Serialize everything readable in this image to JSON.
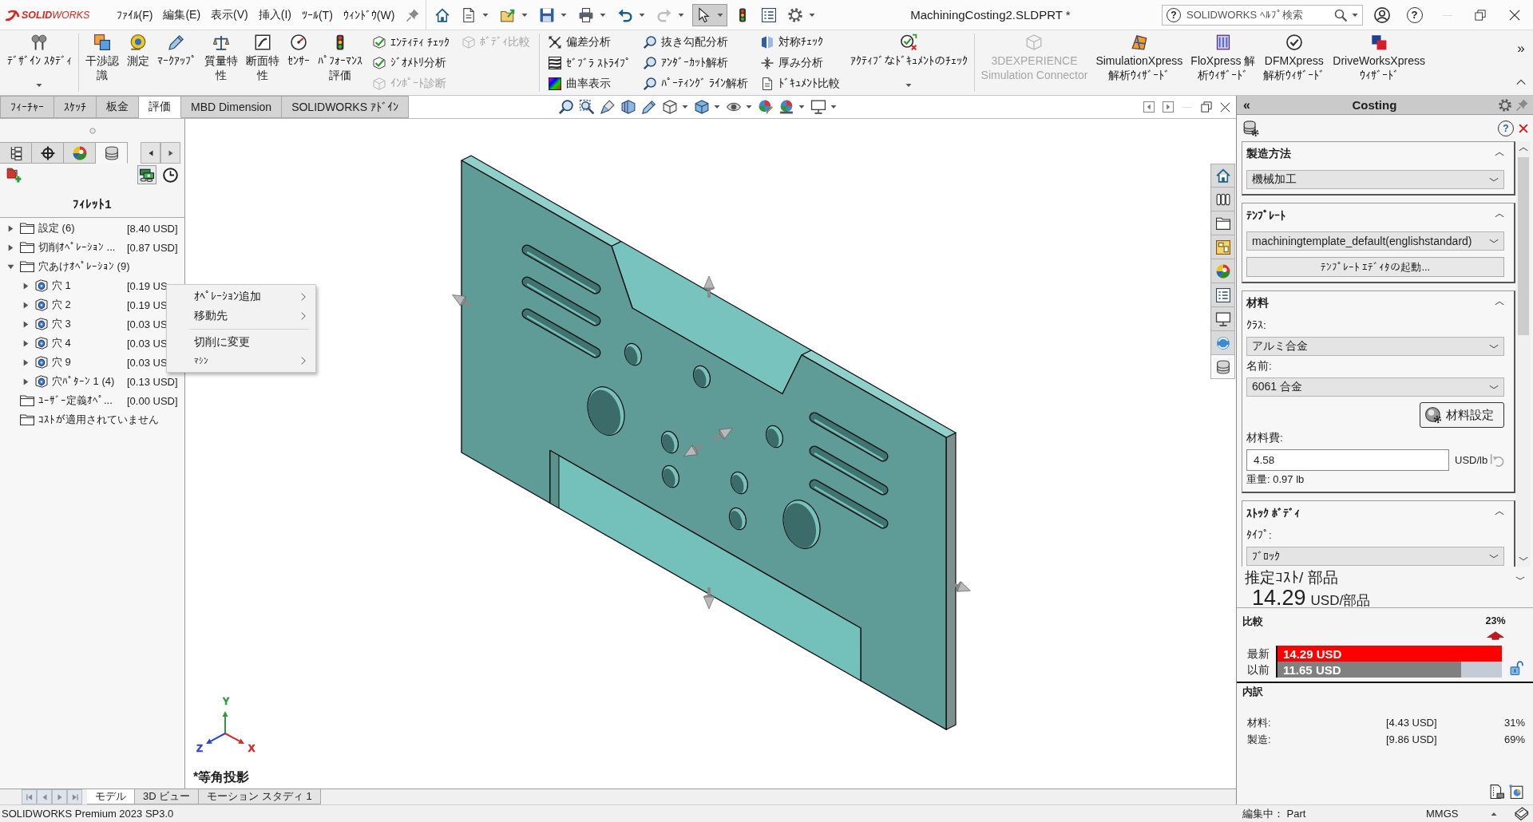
{
  "title_bar": {
    "logo": "**SOLID**WORKS",
    "menus": [
      "ﾌｧｲﾙ(F)",
      "編集(E)",
      "表示(V)",
      "挿入(I)",
      "ﾂｰﾙ(T)",
      "ｳｨﾝﾄﾞｳ(W)"
    ],
    "document_title": "MachiningCosting2.SLDPRT *",
    "search": {
      "help": "?",
      "placeholder": "SOLIDWORKS ﾍﾙﾌﾟ検索"
    },
    "help": "?"
  },
  "quick_access": [
    {
      "kind": "home",
      "dropdown": false,
      "selected": false,
      "disabled": false
    },
    {
      "kind": "new",
      "dropdown": true,
      "selected": false,
      "disabled": false
    },
    {
      "kind": "open",
      "dropdown": true,
      "selected": false,
      "disabled": false
    },
    {
      "kind": "save",
      "dropdown": true,
      "selected": false,
      "disabled": false
    },
    {
      "kind": "print",
      "dropdown": true,
      "selected": false,
      "disabled": false
    },
    {
      "kind": "undo",
      "dropdown": true,
      "selected": false,
      "disabled": false
    },
    {
      "kind": "redo",
      "dropdown": true,
      "selected": false,
      "disabled": true
    },
    {
      "kind": "select",
      "dropdown": true,
      "selected": true,
      "disabled": false
    },
    {
      "kind": "rebuild",
      "dropdown": false,
      "selected": false,
      "disabled": false
    },
    {
      "kind": "file_properties",
      "dropdown": false,
      "selected": false,
      "disabled": false
    },
    {
      "kind": "options",
      "dropdown": true,
      "selected": false,
      "disabled": false
    }
  ],
  "ribbon": [
    {
      "kind": "large",
      "lines": [
        "ﾃﾞｻﾞｲﾝ ｽﾀﾃﾞｨ"
      ],
      "dropdown": true,
      "disabled": false
    },
    {
      "kind": "separator"
    },
    {
      "kind": "large",
      "lines": [
        "干渉認",
        "識"
      ],
      "dropdown": false,
      "disabled": false
    },
    {
      "kind": "large",
      "lines": [
        "測定"
      ],
      "dropdown": false,
      "disabled": false
    },
    {
      "kind": "large",
      "lines": [
        "ﾏｰｸｱｯﾌﾟ"
      ],
      "dropdown": false,
      "disabled": false
    },
    {
      "kind": "large",
      "lines": [
        "質量特",
        "性"
      ],
      "dropdown": false,
      "disabled": false
    },
    {
      "kind": "large",
      "lines": [
        "断面特",
        "性"
      ],
      "dropdown": false,
      "disabled": false
    },
    {
      "kind": "large",
      "lines": [
        "ｾﾝｻｰ"
      ],
      "dropdown": false,
      "disabled": false
    },
    {
      "kind": "large",
      "lines": [
        "ﾊﾟﾌｫｰﾏﾝｽ",
        "評価"
      ],
      "dropdown": false,
      "disabled": false
    },
    {
      "kind": "stack",
      "items": [
        {
          "label": "ｴﾝﾃｨﾃｨ ﾁｪｯｸ",
          "disabled": false
        },
        {
          "label": "ｼﾞｵﾒﾄﾘ分析",
          "disabled": false
        },
        {
          "label": "ｲﾝﾎﾟｰﾄ診断",
          "disabled": true
        }
      ]
    },
    {
      "kind": "stack",
      "items": [
        {
          "label": "ﾎﾞﾃﾞｨ比較",
          "disabled": true
        }
      ]
    },
    {
      "kind": "separator"
    },
    {
      "kind": "stack",
      "items": [
        {
          "label": "偏差分析",
          "disabled": false
        },
        {
          "label": "ｾﾞﾌﾞﾗ ｽﾄﾗｲﾌﾟ",
          "disabled": false
        },
        {
          "label": "曲率表示",
          "disabled": false
        }
      ]
    },
    {
      "kind": "stack",
      "items": [
        {
          "label": "抜き勾配分析",
          "disabled": false
        },
        {
          "label": "ｱﾝﾀﾞｰｶｯﾄ解析",
          "disabled": false
        },
        {
          "label": "ﾊﾟｰﾃｨﾝｸﾞ ﾗｲﾝ解析",
          "disabled": false
        }
      ]
    },
    {
      "kind": "stack",
      "items": [
        {
          "label": "対称ﾁｪｯｸ",
          "disabled": false
        },
        {
          "label": "厚み分析",
          "disabled": false
        },
        {
          "label": "ﾄﾞｷｭﾒﾝﾄ比較",
          "disabled": false
        }
      ]
    },
    {
      "kind": "large",
      "lines": [
        "ｱｸﾃｨﾌﾞなﾄﾞｷｭﾒﾝﾄのﾁｪｯｸ"
      ],
      "dropdown": true,
      "disabled": false
    },
    {
      "kind": "separator"
    },
    {
      "kind": "large",
      "lines": [
        "3DEXPERIENCE",
        "Simulation Connector"
      ],
      "dropdown": false,
      "disabled": true
    },
    {
      "kind": "large",
      "lines": [
        "SimulationXpress",
        "解析ｳｨｻﾞｰﾄﾞ"
      ],
      "dropdown": false,
      "disabled": false
    },
    {
      "kind": "large",
      "lines": [
        "FloXpress 解",
        "析ｳｨｻﾞｰﾄﾞ"
      ],
      "dropdown": false,
      "disabled": false
    },
    {
      "kind": "large",
      "lines": [
        "DFMXpress",
        "解析ｳｨｻﾞｰﾄﾞ"
      ],
      "dropdown": false,
      "disabled": false
    },
    {
      "kind": "large",
      "lines": [
        "DriveWorksXpress",
        "ｳｨｻﾞｰﾄﾞ"
      ],
      "dropdown": false,
      "disabled": false
    }
  ],
  "ribbon_more": "»",
  "command_tabs": [
    {
      "label": "ﾌｨｰﾁｬｰ",
      "selected": false
    },
    {
      "label": "ｽｹｯﾁ",
      "selected": false
    },
    {
      "label": "板金",
      "selected": false
    },
    {
      "label": "評価",
      "selected": true
    },
    {
      "label": "MBD Dimension",
      "selected": false
    },
    {
      "label": "SOLIDWORKS ｱﾄﾞｲﾝ",
      "selected": false
    }
  ],
  "manager_tabs": [
    {
      "kind": "feature_tree",
      "selected": false
    },
    {
      "kind": "property",
      "selected": false
    },
    {
      "kind": "display",
      "selected": false
    },
    {
      "kind": "costing",
      "selected": true
    }
  ],
  "cost_tree": {
    "title": "ﾌｨﾚｯﾄ1",
    "items": [
      {
        "kind": "folder",
        "label": "設定 (6)",
        "cost": "[8.40 USD]",
        "expanded": false
      },
      {
        "kind": "folder",
        "label": "切削ｵﾍﾟﾚｰｼｮﾝ ...",
        "cost": "[0.87 USD]",
        "expanded": false
      },
      {
        "kind": "folder",
        "label": "穴あけｵﾍﾟﾚｰｼｮﾝ (9)",
        "expanded": true,
        "children": [
          {
            "kind": "hole",
            "label": "穴 1",
            "cost": "[0.19 US",
            "expanded": false
          },
          {
            "kind": "hole",
            "label": "穴 2",
            "cost": "[0.19 US",
            "expanded": false
          },
          {
            "kind": "hole",
            "label": "穴 3",
            "cost": "[0.03 US",
            "expanded": false
          },
          {
            "kind": "hole",
            "label": "穴 4",
            "cost": "[0.03 US",
            "expanded": false
          },
          {
            "kind": "hole",
            "label": "穴 9",
            "cost": "[0.03 US",
            "expanded": false
          },
          {
            "kind": "hole",
            "label": "穴ﾊﾟﾀｰﾝ 1 (4)",
            "cost": "[0.13 USD]",
            "expanded": false
          }
        ]
      },
      {
        "kind": "folder",
        "label": "ﾕｰｻﾞｰ定義ｵﾍﾟ...",
        "cost": "[0.00 USD]"
      },
      {
        "kind": "folder",
        "label": "ｺｽﾄが適用されていません"
      }
    ]
  },
  "context_menu": {
    "items": [
      {
        "kind": "item",
        "label": "ｵﾍﾟﾚｰｼｮﾝ追加",
        "submenu": true
      },
      {
        "kind": "item",
        "label": "移動先",
        "submenu": true
      },
      {
        "kind": "separator"
      },
      {
        "kind": "item",
        "label": "切削に変更",
        "submenu": false
      },
      {
        "kind": "compact",
        "label": "ﾏｼﾝ",
        "submenu": true
      }
    ]
  },
  "viewport": {
    "view_name": "*等角投影",
    "axis_labels": [
      {
        "label": "Y",
        "color": "#2e9a3c"
      },
      {
        "label": "Z",
        "color": "#2b46c8"
      },
      {
        "label": "X",
        "color": "#d42a2a"
      }
    ]
  },
  "task_pane": [
    {
      "kind": "home",
      "selected": false
    },
    {
      "kind": "parts",
      "selected": false
    },
    {
      "kind": "folder",
      "selected": false
    },
    {
      "kind": "palette",
      "selected": false
    },
    {
      "kind": "appearance",
      "selected": false
    },
    {
      "kind": "properties",
      "selected": false
    },
    {
      "kind": "monitor",
      "selected": false
    },
    {
      "kind": "sync",
      "selected": false
    },
    {
      "kind": "costing",
      "selected": true
    }
  ],
  "bottom_tabs": [
    {
      "label": "モデル",
      "selected": true
    },
    {
      "label": "3D ビュー",
      "selected": false
    },
    {
      "label": "モーション スタディ 1",
      "selected": false
    }
  ],
  "costing_panel": {
    "collapse": "«",
    "title": "Costing",
    "help": "?",
    "groups": [
      {
        "title": "製造方法",
        "expanded": true,
        "fields": [
          {
            "kind": "select",
            "value": "機械加工"
          }
        ]
      },
      {
        "title": "ﾃﾝﾌﾟﾚｰﾄ",
        "expanded": true,
        "fields": [
          {
            "kind": "select",
            "value": "machiningtemplate_default(englishstandard)"
          },
          {
            "kind": "button",
            "label": "ﾃﾝﾌﾟﾚｰﾄ ｴﾃﾞｨﾀの起動..."
          }
        ]
      },
      {
        "title": "材料",
        "expanded": true,
        "fields": [
          {
            "kind": "label",
            "text": "ｸﾗｽ:"
          },
          {
            "kind": "select",
            "value": "アルミ合金"
          },
          {
            "kind": "label",
            "text": "名前:"
          },
          {
            "kind": "select",
            "value": "6061 合金"
          },
          {
            "kind": "icon_button",
            "label": "材料設定"
          },
          {
            "kind": "label",
            "text": "材料費:"
          },
          {
            "kind": "input",
            "value": "4.58",
            "unit": "USD/lb"
          },
          {
            "kind": "note",
            "text": "重量: 0.97 lb"
          }
        ]
      },
      {
        "title": "ｽﾄｯｸ ﾎﾞﾃﾞｨ",
        "expanded": true,
        "fields": [
          {
            "kind": "label",
            "text": "ﾀｲﾌﾟ:"
          },
          {
            "kind": "select",
            "value": "ﾌﾞﾛｯｸ"
          }
        ]
      }
    ],
    "estimate": {
      "title": "推定ｺｽﾄ/ 部品",
      "value": "14.29",
      "unit": "USD/部品"
    },
    "comparison": {
      "title": "比較",
      "change": "23%",
      "bars": [
        {
          "label": "最新",
          "value": "14.29 USD",
          "level": 1,
          "color": "#ff0000"
        },
        {
          "label": "以前",
          "value": "11.65 USD",
          "level": 0.82,
          "color": "#808080"
        }
      ]
    },
    "breakdown": {
      "title": "内訳",
      "rows": [
        {
          "label": "材料:",
          "cost": "[4.43 USD]",
          "share": "31%"
        },
        {
          "label": "製造:",
          "cost": "[9.86 USD]",
          "share": "69%"
        }
      ]
    }
  },
  "status_bar": {
    "product": "SOLIDWORKS Premium 2023 SP3.0",
    "mode": "編集中： Part",
    "units": "MMGS"
  }
}
